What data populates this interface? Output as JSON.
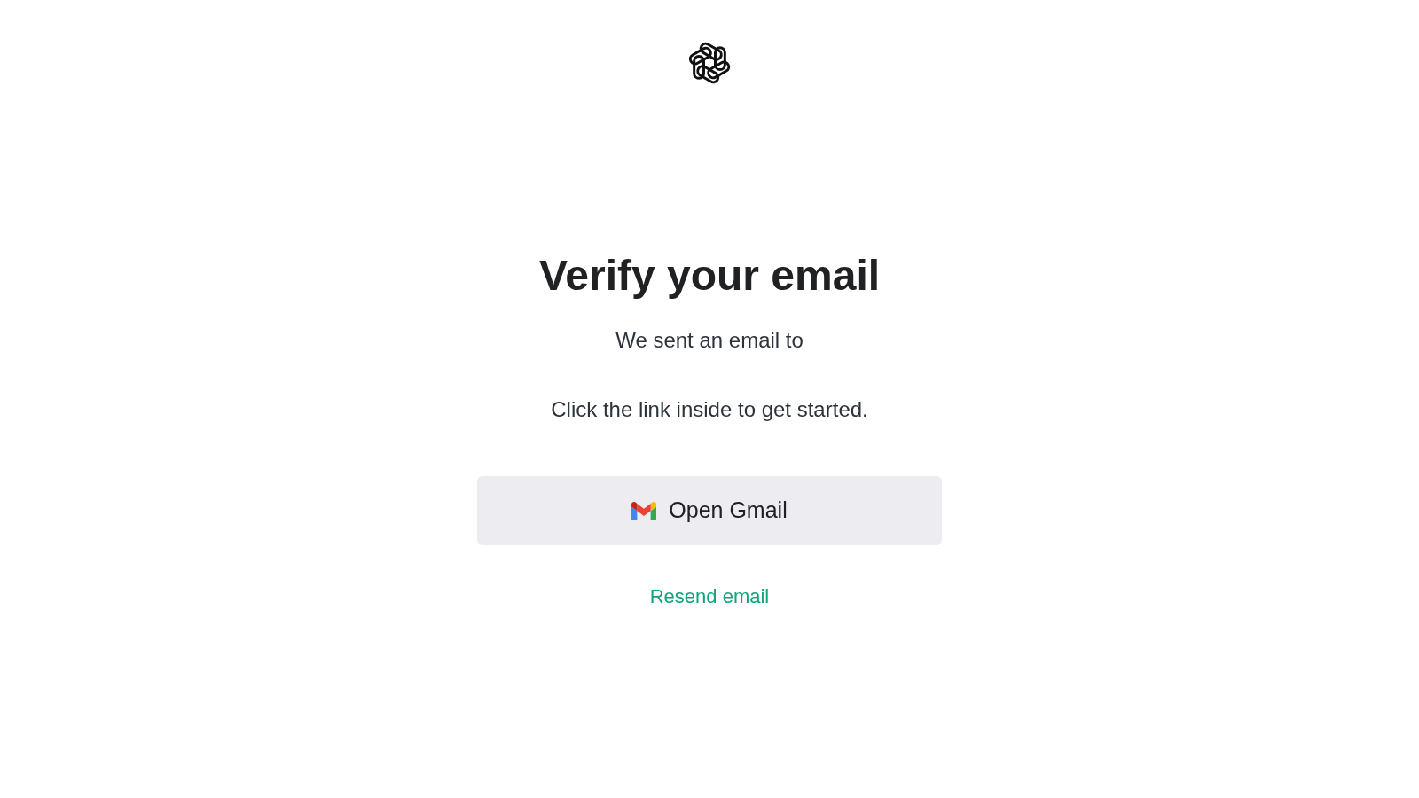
{
  "title": "Verify your email",
  "message": "We sent an email to",
  "instruction": "Click the link inside to get started.",
  "open_button": {
    "label": "Open Gmail"
  },
  "resend_link": {
    "label": "Resend email"
  }
}
